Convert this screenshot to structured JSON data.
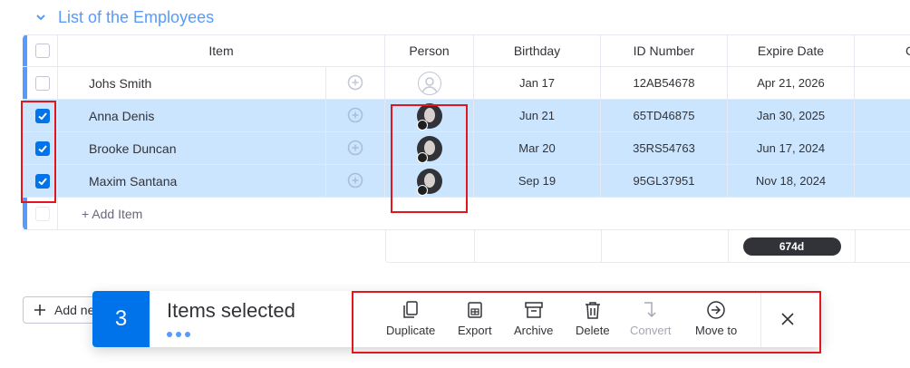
{
  "group": {
    "title": "List of the Employees"
  },
  "columns": [
    "Item",
    "Person",
    "Birthday",
    "ID Number",
    "Expire Date",
    "C"
  ],
  "rows": [
    {
      "name": "Johs Smith",
      "birthday": "Jan 17",
      "id": "12AB54678",
      "expire": "Apr 21, 2026",
      "selected": false
    },
    {
      "name": "Anna Denis",
      "birthday": "Jun 21",
      "id": "65TD46875",
      "expire": "Jan 30, 2025",
      "selected": true
    },
    {
      "name": "Brooke Duncan",
      "birthday": "Mar 20",
      "id": "35RS54763",
      "expire": "Jun 17, 2024",
      "selected": true
    },
    {
      "name": "Maxim Santana",
      "birthday": "Sep 19",
      "id": "95GL37951",
      "expire": "Nov 18, 2024",
      "selected": true
    }
  ],
  "add_item": "+ Add Item",
  "summary": {
    "expire_span": "674d"
  },
  "add_group_button": "Add ne",
  "toolbar": {
    "count": "3",
    "selected_label": "Items selected",
    "actions": [
      "Duplicate",
      "Export",
      "Archive",
      "Delete",
      "Convert",
      "Move to"
    ]
  },
  "colors": {
    "accent": "#0073ea",
    "group": "#579bfc",
    "selected_row": "#cce5ff",
    "highlight": "#e2161d"
  },
  "icons": [
    "chevron-down-icon",
    "add-update-icon",
    "empty-person-icon",
    "avatar",
    "duplicate-icon",
    "export-icon",
    "archive-icon",
    "delete-icon",
    "convert-icon",
    "move-to-icon",
    "close-icon",
    "plus-icon"
  ]
}
